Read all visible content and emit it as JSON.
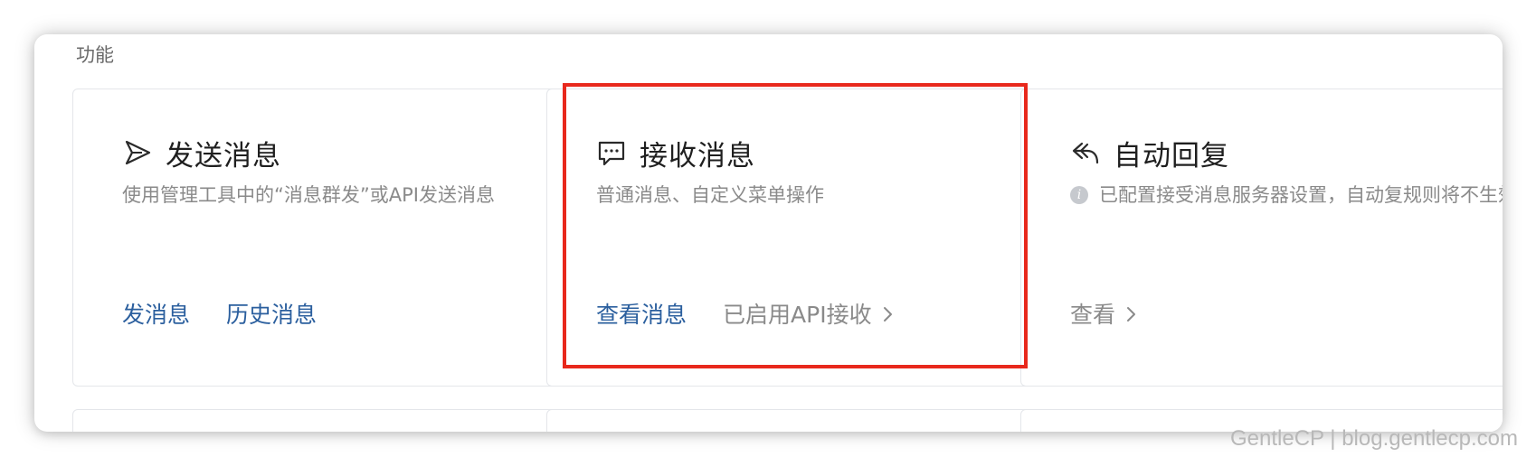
{
  "section": {
    "title": "功能"
  },
  "cards": [
    {
      "title": "发送消息",
      "icon": "send-icon",
      "description": "使用管理工具中的“消息群发”或API发送消息",
      "links": [
        "发消息",
        "历史消息"
      ]
    },
    {
      "title": "接收消息",
      "icon": "message-icon",
      "description": "普通消息、自定义菜单操作",
      "link": "查看消息",
      "status_link": "已启用API接收"
    },
    {
      "title": "自动回复",
      "icon": "reply-icon",
      "description": "已配置接受消息服务器设置，自动复规则将不生效",
      "status_link": "查看"
    }
  ],
  "watermark": "GentleCP | blog.gentlecp.com",
  "colors": {
    "link": "#2b5f9e",
    "highlight": "#e8281c",
    "muted": "#8a8a8a"
  }
}
